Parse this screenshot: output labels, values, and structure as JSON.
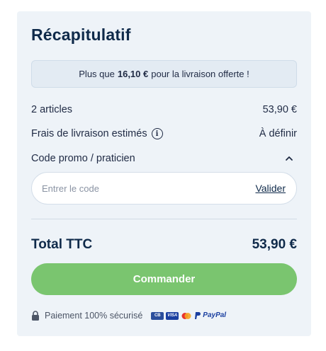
{
  "summary": {
    "title": "Récapitulatif",
    "banner": {
      "prefix": "Plus que",
      "amount": "16,10 €",
      "suffix": "pour la livraison offerte !"
    },
    "items": {
      "label": "2 articles",
      "value": "53,90 €"
    },
    "shipping": {
      "label": "Frais de livraison estimés",
      "value": "À définir",
      "info_icon": "info-icon"
    },
    "promo": {
      "label": "Code promo / praticien",
      "toggle_icon": "chevron-up-icon",
      "placeholder": "Entrer le code",
      "validate_label": "Valider"
    },
    "total": {
      "label": "Total TTC",
      "value": "53,90 €"
    },
    "order_button": "Commander",
    "secure_text": "Paiement 100% sécurisé",
    "payment_icons": [
      "cb-card-icon",
      "visa-icon",
      "mastercard-icon",
      "paypal-icon"
    ],
    "paypal_label": "PayPal",
    "colors": {
      "accent_green": "#7ac56f",
      "navy": "#0f2a4a",
      "card_bg": "#eef3f8"
    }
  }
}
